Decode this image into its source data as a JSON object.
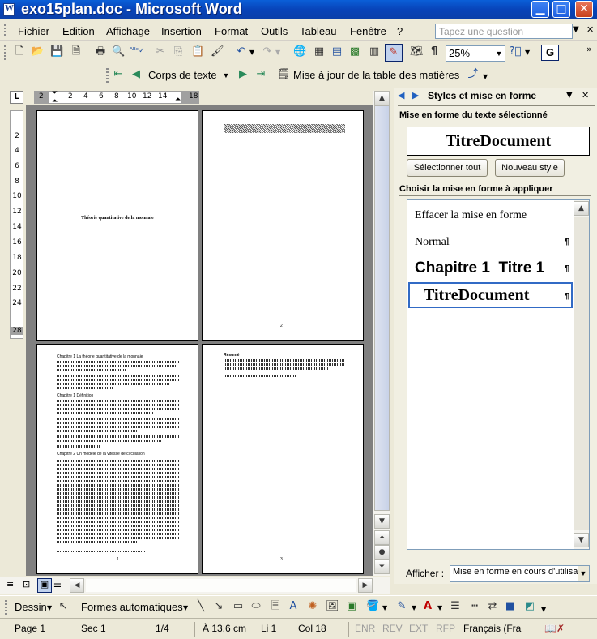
{
  "window": {
    "title": "exo15plan.doc - Microsoft Word"
  },
  "menu": {
    "items": [
      "Fichier",
      "Edition",
      "Affichage",
      "Insertion",
      "Format",
      "Outils",
      "Tableau",
      "Fenêtre",
      "?"
    ],
    "ask_placeholder": "Tapez une question"
  },
  "toolbar": {
    "zoom": "25%",
    "style_combo": "Corps de texte",
    "update_toc": "Mise à jour de la table des matières",
    "bold_label": "G"
  },
  "ruler": {
    "h_ticks": [
      "2",
      "2",
      "4",
      "6",
      "8",
      "10",
      "12",
      "14",
      "18"
    ],
    "v_ticks": [
      "2",
      "4",
      "6",
      "8",
      "10",
      "12",
      "14",
      "16",
      "18",
      "20",
      "22",
      "24",
      "28"
    ]
  },
  "document": {
    "page1_title": "Théorie quantitative de la monnaie",
    "page2_number": "2",
    "page3_number": "1",
    "page4_number": "3",
    "page3_heading1": "Chapitre 1 La théorie quantitative de la monnaie",
    "page3_heading2": "Chapitre 1 Définition",
    "page3_heading3": "Chapitre 2 Un modèle de la vitesse de circulation",
    "page4_heading": "Résumé"
  },
  "pane": {
    "title": "Styles et mise en forme",
    "section_selected": "Mise en forme du texte sélectionné",
    "selected_style": "TitreDocument",
    "select_all": "Sélectionner tout",
    "new_style": "Nouveau style",
    "section_choose": "Choisir la mise en forme à appliquer",
    "styles": [
      {
        "label": "Effacer la mise en forme",
        "mark": ""
      },
      {
        "label": "Normal",
        "mark": "¶"
      },
      {
        "label": "Chapitre 1  Titre 1",
        "mark": "¶"
      },
      {
        "label": "TitreDocument",
        "mark": "¶"
      }
    ],
    "show_label": "Afficher :",
    "show_value": "Mise en forme en cours d'utilisation"
  },
  "drawbar": {
    "draw": "Dessin",
    "autoshapes": "Formes automatiques"
  },
  "status": {
    "page": "Page 1",
    "sec": "Sec 1",
    "pos": "1/4",
    "at": "À 13,6 cm",
    "line": "Li 1",
    "col": "Col 18",
    "rec": "ENR",
    "rev": "REV",
    "ext": "EXT",
    "ovr": "RFP",
    "lang": "Français (Fra"
  }
}
